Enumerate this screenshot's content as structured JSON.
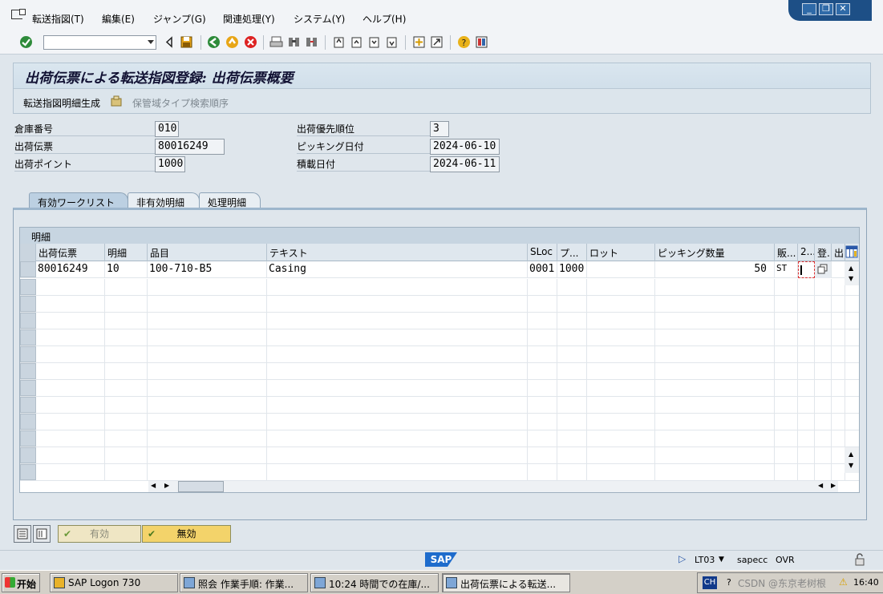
{
  "menu": {
    "items": [
      "転送指図(T)",
      "編集(E)",
      "ジャンプ(G)",
      "関連処理(Y)",
      "システム(Y)",
      "ヘルプ(H)"
    ]
  },
  "title": "出荷伝票による転送指図登録: 出荷伝票概要",
  "app_toolbar": {
    "generate_label": "転送指図明細生成",
    "storage_type_label": "保管域タイプ検索順序"
  },
  "header": {
    "warehouse_label": "倉庫番号",
    "warehouse_value": "010",
    "delivery_label": "出荷伝票",
    "delivery_value": "80016249",
    "shipping_point_label": "出荷ポイント",
    "shipping_point_value": "1000",
    "priority_label": "出荷優先順位",
    "priority_value": "3",
    "picking_date_label": "ピッキング日付",
    "picking_date_value": "2024-06-10",
    "loading_date_label": "積載日付",
    "loading_date_value": "2024-06-11"
  },
  "tabs": [
    "有効ワークリスト",
    "非有効明細",
    "処理明細"
  ],
  "table": {
    "caption": "明細",
    "columns": [
      "出荷伝票",
      "明細",
      "品目",
      "テキスト",
      "SLoc",
      "プ...",
      "ロット",
      "ピッキング数量",
      "販...",
      "2...",
      "登...",
      "出..."
    ],
    "rows": [
      [
        "80016249",
        "10",
        "100-710-B5",
        "Casing",
        "0001",
        "1000",
        "",
        "50",
        "ST",
        "",
        "",
        ""
      ]
    ]
  },
  "bottom_buttons": {
    "active_label": "有効",
    "inactive_label": "無効"
  },
  "status": {
    "logo": "SAP",
    "transaction": "LT03",
    "server": "sapecc",
    "mode": "OVR"
  },
  "taskbar": {
    "start_label": "开始",
    "tasks": [
      "SAP Logon 730",
      "照会 作業手順: 作業...",
      "10:24 時間での在庫/...",
      "出荷伝票による転送..."
    ],
    "tray_lang": "CH",
    "tray_text": "CSDN @东京老树根",
    "clock": "16:40"
  },
  "colors": {
    "sap_blue": "#1e6ccc",
    "active_button": "#f3d36a",
    "title_bg": "#c7d8e5"
  }
}
